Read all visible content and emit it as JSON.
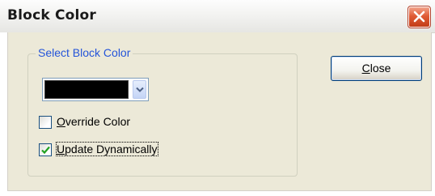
{
  "window": {
    "title": "Block Color",
    "close_glyph": "close-icon"
  },
  "group": {
    "legend": "Select Block Color"
  },
  "color_combo": {
    "selected_color": "#000000",
    "dropdown_icon": "chevron-down-icon"
  },
  "checkboxes": [
    {
      "mnemonic": "O",
      "rest": "verride Color",
      "checked": false
    },
    {
      "mnemonic": "U",
      "rest": "pdate Dynamically",
      "checked": true
    }
  ],
  "buttons": {
    "close": {
      "mnemonic": "C",
      "rest": "lose"
    }
  },
  "colors": {
    "dialog_bg": "#ece9d8",
    "legend_text": "#2454d9",
    "check_mark": "#21a121"
  }
}
